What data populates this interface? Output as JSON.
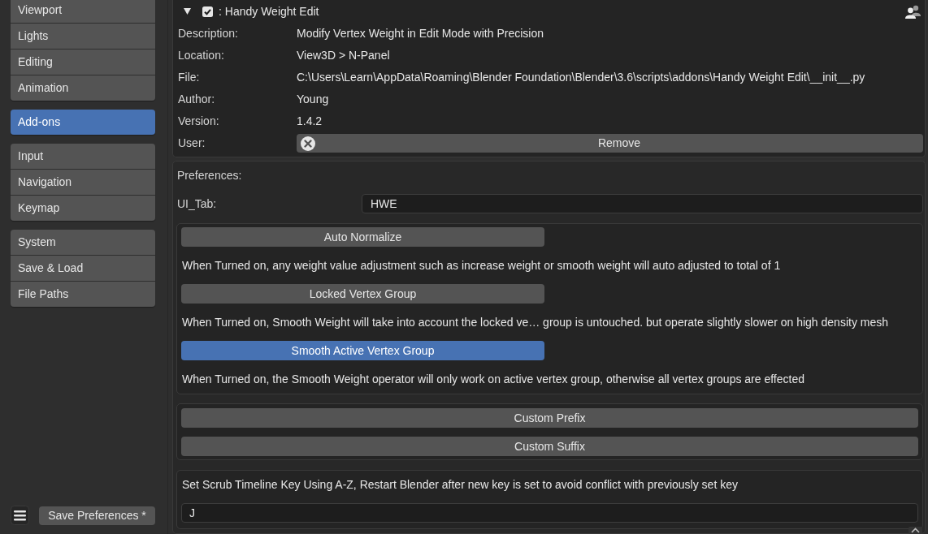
{
  "sidebar": {
    "groups": [
      {
        "items": [
          {
            "label": "Viewport",
            "selected": false
          },
          {
            "label": "Lights",
            "selected": false
          },
          {
            "label": "Editing",
            "selected": false
          },
          {
            "label": "Animation",
            "selected": false
          }
        ]
      },
      {
        "items": [
          {
            "label": "Add-ons",
            "selected": true
          }
        ]
      },
      {
        "items": [
          {
            "label": "Input",
            "selected": false
          },
          {
            "label": "Navigation",
            "selected": false
          },
          {
            "label": "Keymap",
            "selected": false
          }
        ]
      },
      {
        "items": [
          {
            "label": "System",
            "selected": false
          },
          {
            "label": "Save & Load",
            "selected": false
          },
          {
            "label": "File Paths",
            "selected": false
          }
        ]
      }
    ]
  },
  "footer": {
    "save_button": "Save Preferences *"
  },
  "addon": {
    "expanded": true,
    "enabled": true,
    "title": ": Handy Weight Edit",
    "info": [
      {
        "label": "Description:",
        "value": "Modify Vertex Weight in Edit Mode with Precision"
      },
      {
        "label": "Location:",
        "value": "View3D > N-Panel"
      },
      {
        "label": "File:",
        "value": "C:\\Users\\Learn\\AppData\\Roaming\\Blender Foundation\\Blender\\3.6\\scripts\\addons\\Handy Weight Edit\\__init__.py"
      },
      {
        "label": "Author:",
        "value": "Young"
      },
      {
        "label": "Version:",
        "value": "1.4.2"
      }
    ],
    "user": {
      "label": "User:",
      "button": "Remove"
    }
  },
  "preferences": {
    "heading": "Preferences:",
    "ui_tab": {
      "label": "UI_Tab:",
      "value": "HWE"
    },
    "toggles": [
      {
        "label": "Auto Normalize",
        "on": false,
        "description": "When Turned on, any weight value adjustment such as increase weight or smooth weight will auto adjusted to total of 1"
      },
      {
        "label": "Locked Vertex Group",
        "on": false,
        "description": "When Turned on, Smooth Weight will take into account the locked ve… group is untouched. but operate slightly slower on high density mesh"
      },
      {
        "label": "Smooth Active Vertex Group",
        "on": true,
        "description": "When Turned on, the Smooth Weight operator will only work on active vertex group, otherwise all vertex groups are effected"
      }
    ],
    "custom_buttons": [
      "Custom Prefix",
      "Custom Suffix"
    ],
    "scrub_key": {
      "description": "Set Scrub Timeline Key Using A-Z, Restart Blender after new key is set to avoid conflict with previously set key",
      "value": "J"
    }
  }
}
